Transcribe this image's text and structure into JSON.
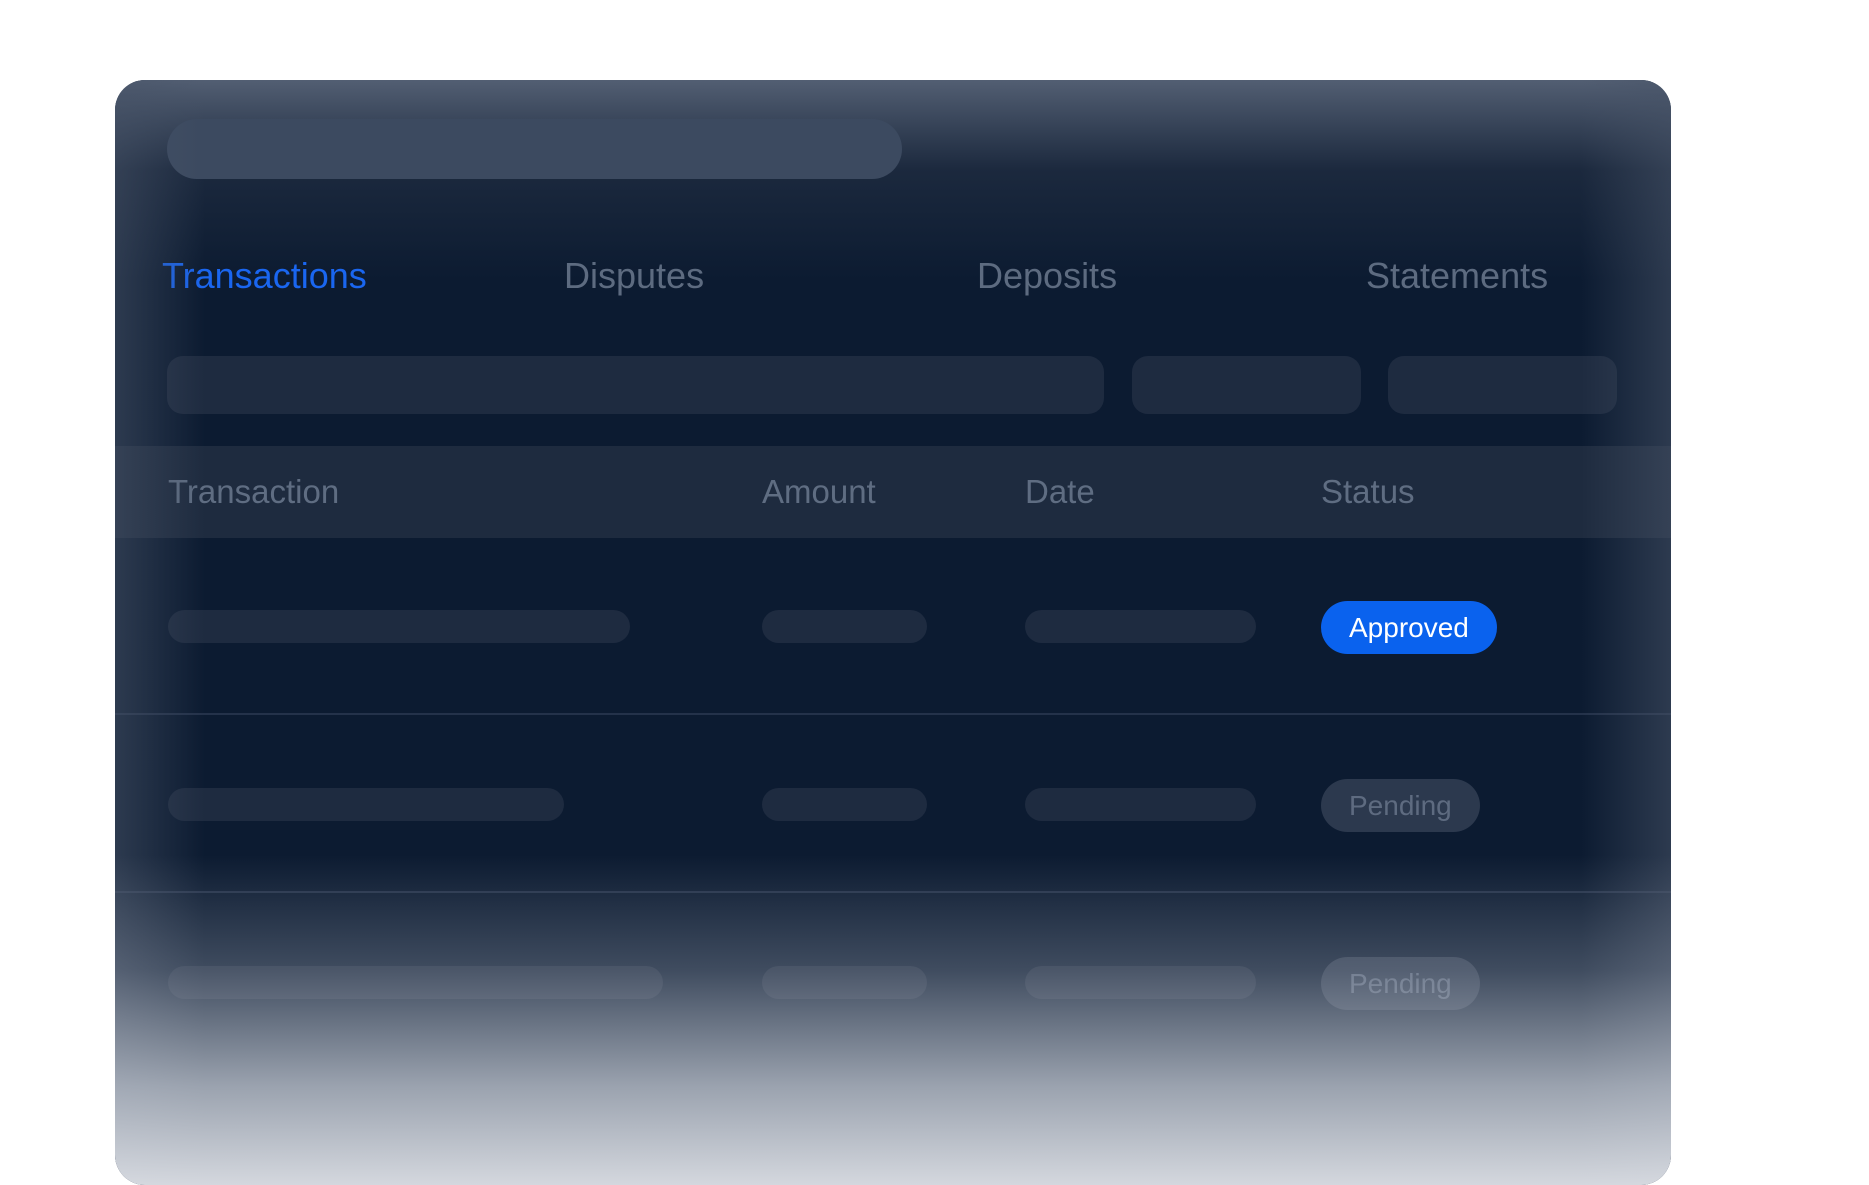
{
  "tabs": [
    {
      "label": "Transactions",
      "active": true
    },
    {
      "label": "Disputes",
      "active": false
    },
    {
      "label": "Deposits",
      "active": false
    },
    {
      "label": "Statements",
      "active": false
    }
  ],
  "table": {
    "columns": [
      "Transaction",
      "Amount",
      "Date",
      "Status"
    ],
    "rows": [
      {
        "status": "Approved"
      },
      {
        "status": "Pending"
      },
      {
        "status": "Pending"
      }
    ]
  },
  "colors": {
    "accent": "#1a66f0",
    "approved_badge": "#0a62ee",
    "card_background": "#0c1b31"
  }
}
